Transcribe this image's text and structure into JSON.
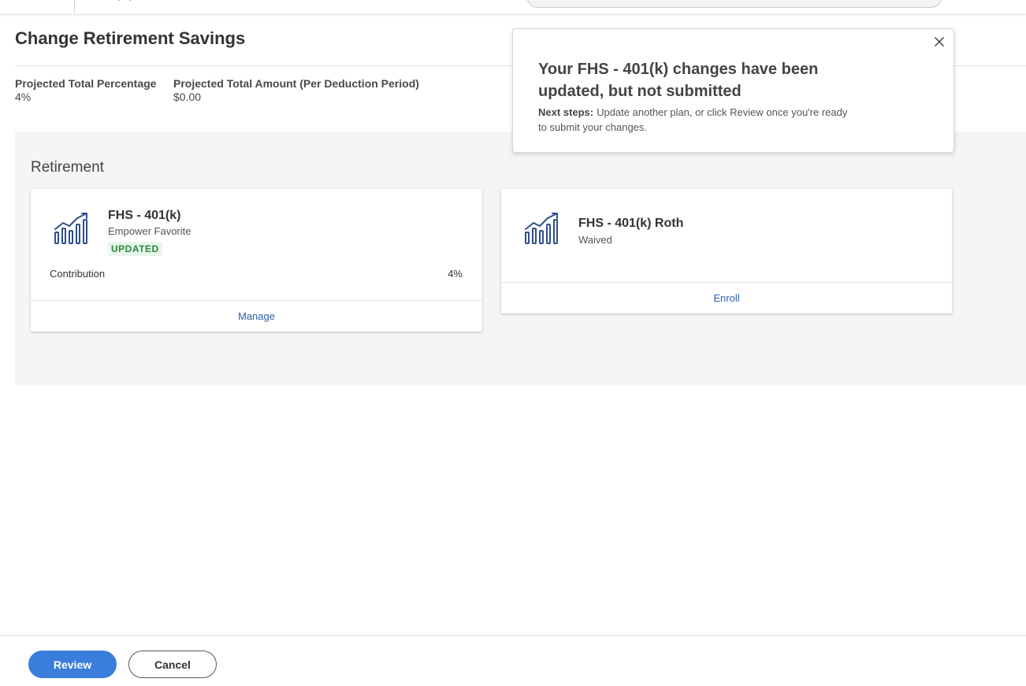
{
  "page": {
    "title": "Change Retirement Savings"
  },
  "summary": {
    "total_percentage_label": "Projected Total Percentage",
    "total_percentage_value": "4%",
    "total_amount_label": "Projected Total Amount (Per Deduction Period)",
    "total_amount_value": "$0.00"
  },
  "section": {
    "title": "Retirement",
    "cards": [
      {
        "icon": "chart-trend-up-icon",
        "name": "FHS - 401(k)",
        "subtitle": "Empower Favorite",
        "badge": "UPDATED",
        "contribution_label": "Contribution",
        "contribution_value": "4%",
        "action": "Manage"
      },
      {
        "icon": "chart-trend-up-icon",
        "name": "FHS - 401(k) Roth",
        "subtitle": "Waived",
        "action": "Enroll"
      }
    ]
  },
  "toast": {
    "heading": "Your FHS - 401(k) changes have been updated, but not submitted",
    "next_steps_label": "Next steps:",
    "next_steps_text": "Update another plan, or click Review once you're ready to submit your changes.",
    "close_icon": "close-icon"
  },
  "footer": {
    "review_label": "Review",
    "cancel_label": "Cancel"
  },
  "colors": {
    "primary": "#3b7ddd",
    "link": "#2f5ea8",
    "badge_bg": "#e9f6ec",
    "badge_text": "#2b8a3e",
    "icon": "#2e4f8f",
    "section_bg": "#f4f5f7"
  }
}
